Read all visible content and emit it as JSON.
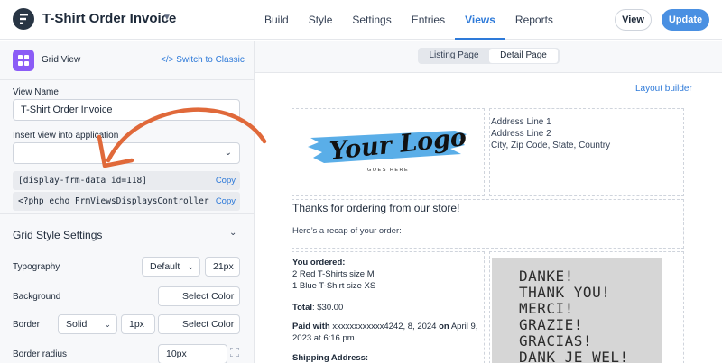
{
  "header": {
    "app_title": "T-Shirt Order Invoice",
    "nav": [
      "Build",
      "Style",
      "Settings",
      "Entries",
      "Views",
      "Reports"
    ],
    "active_nav": "Views",
    "view_button": "View",
    "update_button": "Update"
  },
  "sidebar": {
    "grid_view_label": "Grid View",
    "switch_label": "</> Switch to Classic",
    "view_name_label": "View Name",
    "view_name_value": "T-Shirt Order Invoice",
    "insert_label": "Insert view into application",
    "insert_value": "",
    "shortcode": "[display-frm-data id=118]",
    "php_code": "<?php echo FrmViewsDisplaysController::get_shortcode",
    "copy_label": "Copy",
    "grid_style_title": "Grid Style Settings",
    "typography_label": "Typography",
    "typography_value": "Default",
    "typography_size": "21px",
    "background_label": "Background",
    "background_button": "Select Color",
    "border_label": "Border",
    "border_style": "Solid",
    "border_width": "1px",
    "border_button": "Select Color",
    "border_radius_label": "Border radius",
    "border_radius_value": "10px"
  },
  "canvas": {
    "tabs": [
      "Listing Page",
      "Detail Page"
    ],
    "active_tab": "Detail Page",
    "layout_builder": "Layout builder",
    "logo_text": "Your Logo",
    "logo_tagline": "GOES HERE",
    "address_lines": [
      "Address Line 1",
      "Address Line 2",
      "City, Zip Code, State, Country"
    ],
    "thanks": "Thanks for ordering from our store!",
    "recap": "Here’s a recap of your order:",
    "you_ordered_label": "You ordered:",
    "order_items": [
      "2 Red T-Shirts size M",
      "1 Blue T-Shirt size XS"
    ],
    "total_label": "Total",
    "total_value": ": $30.00",
    "paid_with_label": "Paid with",
    "paid_card": " xxxxxxxxxxxx4242, 8, 2024 ",
    "paid_on_label": "on",
    "paid_date": " April 9,",
    "paid_time": "2023 at 6:16 pm",
    "shipping_label": "Shipping Address:",
    "photo_text": "DANKE!\nTHANK YOU!\nMERCI!\nGRAZIE!\nGRACIAS!\nDANK JE WEL!"
  },
  "colors": {
    "accent": "#4a90e2",
    "link": "#2e7ad9",
    "annotation_arrow": "#e0693a",
    "grid_view_icon": "#8b5cf6",
    "logo_brush": "#5aaee8"
  }
}
